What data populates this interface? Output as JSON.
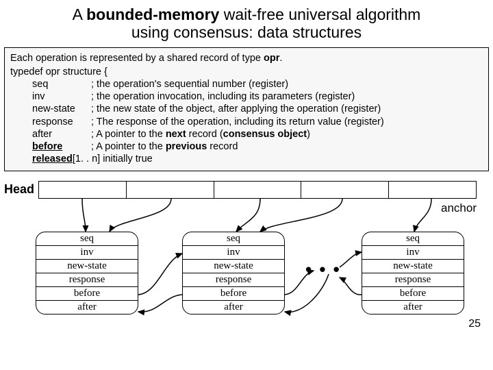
{
  "title": {
    "prefix": "A ",
    "bold": "bounded-memory",
    "rest": " wait-free universal algorithm",
    "line2": "using consensus: data structures"
  },
  "def": {
    "intro_a": "Each operation is represented by a shared record of type ",
    "intro_b": "opr",
    "intro_c": ".",
    "typedef": "typedef opr structure {",
    "fields": [
      {
        "kw": "seq",
        "desc": "; the operation's sequential number (register)"
      },
      {
        "kw": "inv",
        "desc": "; the operation invocation, including its parameters (register)"
      },
      {
        "kw": "new-state",
        "desc": "; the new state of the object, after applying the operation (register)"
      },
      {
        "kw": "response",
        "desc": "; The response of the operation, including its return value (register)"
      }
    ],
    "after": {
      "kw": "after",
      "pre": "; A pointer to the ",
      "bold": "next",
      "post": " record (",
      "bold2": "consensus object",
      "tail": ")"
    },
    "before": {
      "kw": "before",
      "pre": "; A pointer to the ",
      "bold": "previous",
      "post": " record"
    },
    "released": {
      "kw": "released",
      "rest": "[1. . n] initially true"
    }
  },
  "head_label": "Head",
  "anchor_label": "anchor",
  "record_rows": [
    "seq",
    "inv",
    "new-state",
    "response",
    "before",
    "after"
  ],
  "dots": "• • •",
  "page": "25"
}
